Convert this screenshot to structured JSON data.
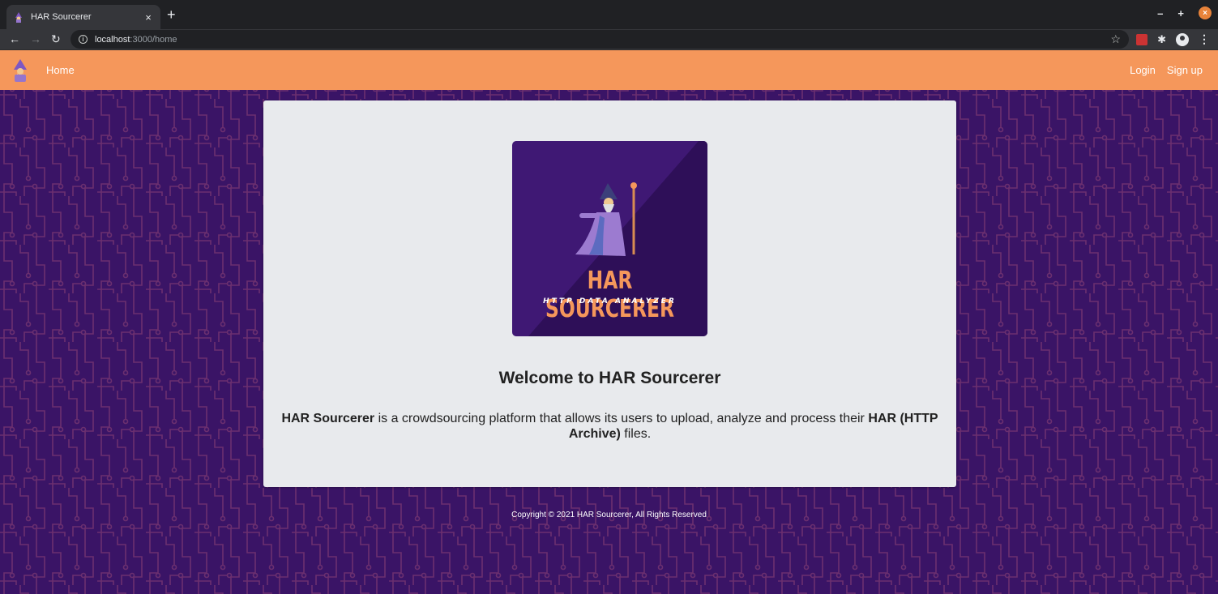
{
  "browser": {
    "tab_title": "HAR Sourcerer",
    "new_tab": "+",
    "close_tab": "×",
    "url_host": "localhost",
    "url_path": ":3000/home",
    "minimize": "–",
    "maximize": "+",
    "close_window": "×"
  },
  "navbar": {
    "home": "Home",
    "login": "Login",
    "signup": "Sign up"
  },
  "card": {
    "logo_title": "HAR SOURCERER",
    "logo_subtitle": "HTTP DATA ANALYZER",
    "welcome": "Welcome to HAR Sourcerer",
    "desc_brand": "HAR Sourcerer",
    "desc_middle": " is a crowdsourcing platform that allows its users to upload, analyze and process their ",
    "desc_bold2": "HAR (HTTP Archive)",
    "desc_end": " files."
  },
  "footer": {
    "copyright": "Copyright © 2021 HAR Sourcerer, All Rights Reserved"
  },
  "colors": {
    "navbar": "#f5975b",
    "background": "#3a1466",
    "circuit": "#6b2f6f",
    "card": "#e8eaed",
    "logo_bg": "#3f1874"
  }
}
